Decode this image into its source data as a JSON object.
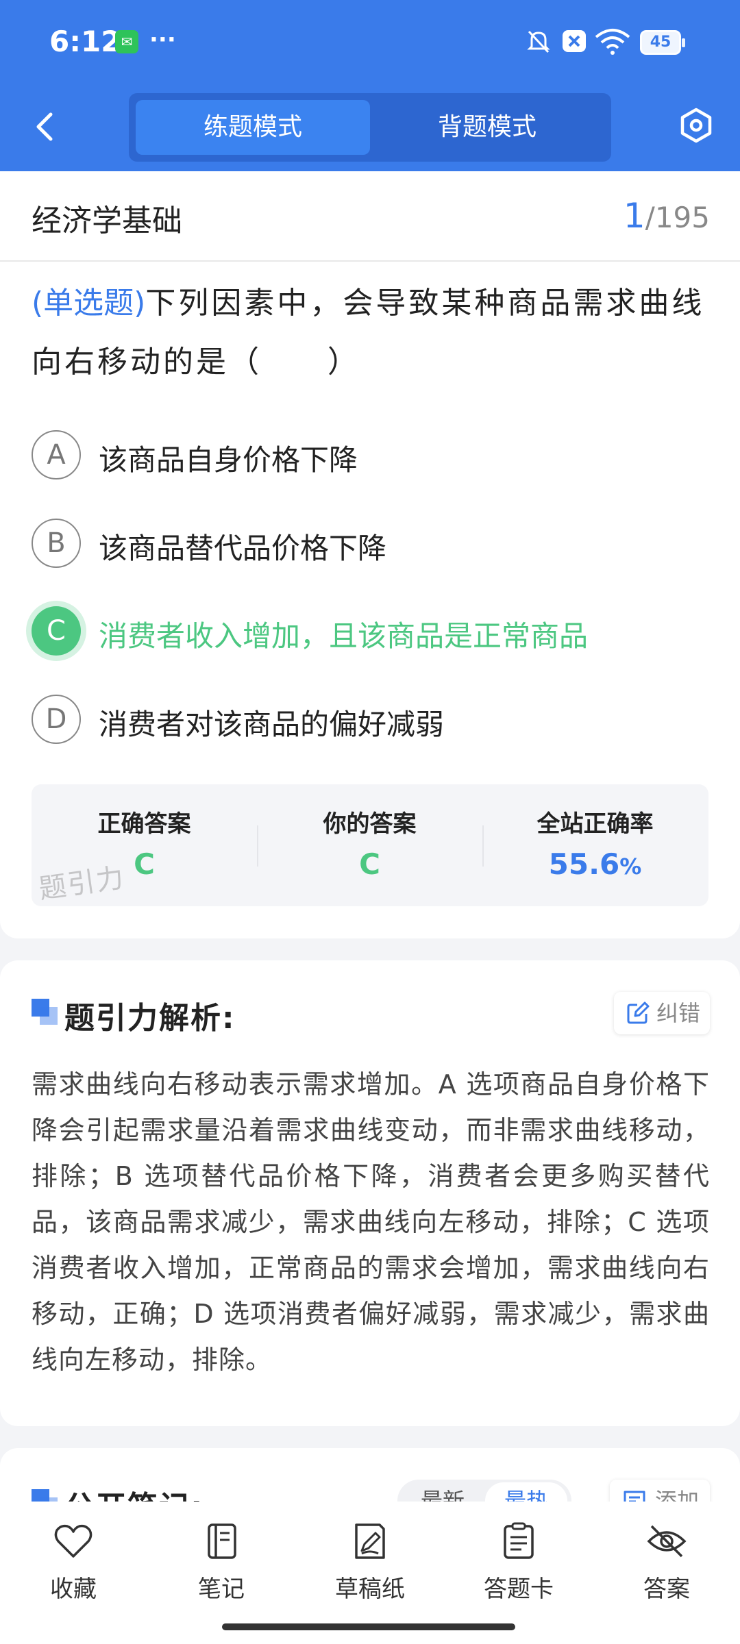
{
  "status_bar": {
    "time": "6:12",
    "overflow": "···",
    "battery": "45",
    "icons": [
      "wechat-icon",
      "mute-icon",
      "close-box-icon",
      "wifi-icon",
      "battery-icon"
    ]
  },
  "header": {
    "tabs": [
      {
        "label": "练题模式",
        "active": true
      },
      {
        "label": "背题模式",
        "active": false
      }
    ],
    "accent_color": "#3a7bea"
  },
  "question": {
    "subject": "经济学基础",
    "current": "1",
    "total": "/195",
    "type_label": "(单选题)",
    "text": "下列因素中，会导致某种商品需求曲线向右移动的是（　　）",
    "options": [
      {
        "letter": "A",
        "text": "该商品自身价格下降",
        "state": "normal"
      },
      {
        "letter": "B",
        "text": "该商品替代品价格下降",
        "state": "normal"
      },
      {
        "letter": "C",
        "text": "消费者收入增加，且该商品是正常商品",
        "state": "correct"
      },
      {
        "letter": "D",
        "text": "消费者对该商品的偏好减弱",
        "state": "normal"
      }
    ]
  },
  "stats": {
    "correct_label": "正确答案",
    "correct_value": "C",
    "yours_label": "你的答案",
    "yours_value": "C",
    "rate_label": "全站正确率",
    "rate_value": "55.6",
    "rate_unit": "%",
    "watermark": "题引力",
    "correct_color": "#4cc781"
  },
  "analysis": {
    "title": "题引力解析:",
    "correction_label": "纠错",
    "text": "需求曲线向右移动表示需求增加。A 选项商品自身价格下降会引起需求量沿着需求曲线变动，而非需求曲线移动，排除；B 选项替代品价格下降，消费者会更多购买替代品，该商品需求减少，需求曲线向左移动，排除；C 选项消费者收入增加，正常商品的需求会增加，需求曲线向右移动，正确；D 选项消费者偏好减弱，需求减少，需求曲线向左移动，排除。"
  },
  "notes": {
    "title": "公开笔记:",
    "sort_options": [
      "最新",
      "最热"
    ],
    "active_sort": "最热",
    "add_label": "添加"
  },
  "bottom_nav": [
    {
      "label": "收藏",
      "icon": "heart-icon"
    },
    {
      "label": "笔记",
      "icon": "notebook-icon"
    },
    {
      "label": "草稿纸",
      "icon": "draft-paper-icon"
    },
    {
      "label": "答题卡",
      "icon": "answer-card-icon"
    },
    {
      "label": "答案",
      "icon": "eye-off-icon"
    }
  ]
}
